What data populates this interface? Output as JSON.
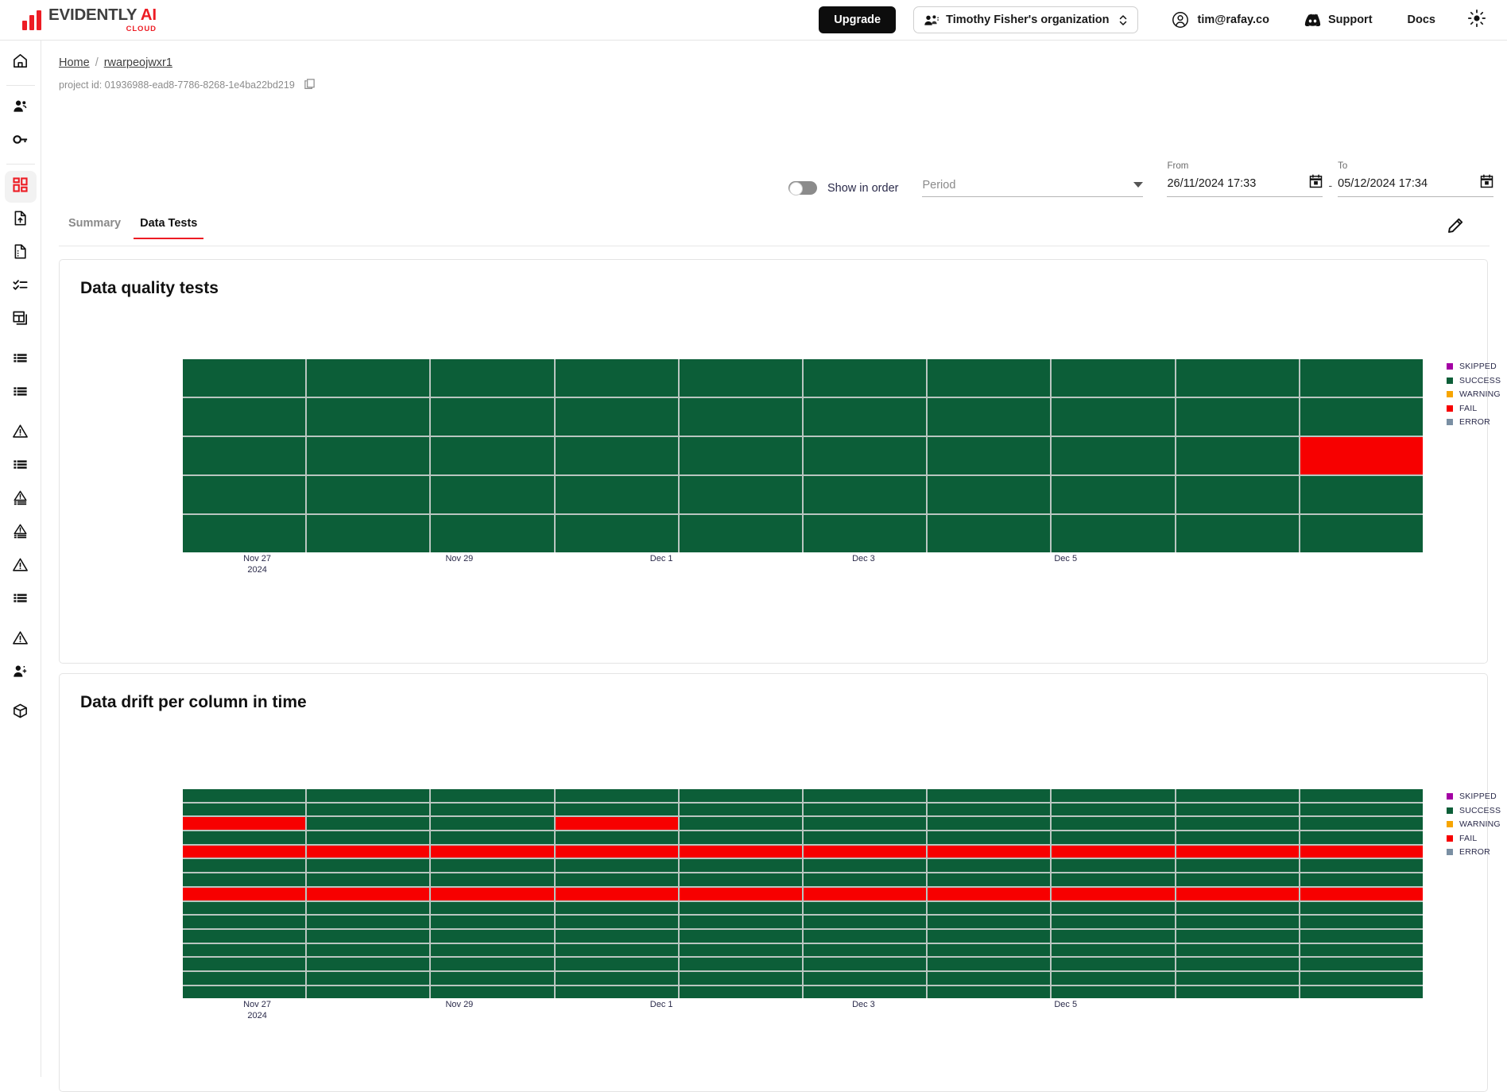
{
  "topbar": {
    "logo": {
      "main": "EVIDENTLY",
      "ai": "AI",
      "sub": "CLOUD"
    },
    "upgrade_label": "Upgrade",
    "org_label": "Timothy Fisher's organization",
    "account_email": "tim@rafay.co",
    "support_label": "Support",
    "docs_label": "Docs"
  },
  "sidebar": {
    "items": [
      {
        "name": "home",
        "icon": "home-icon"
      },
      {
        "name": "team",
        "icon": "users-icon"
      },
      {
        "name": "api-keys",
        "icon": "key-icon"
      },
      {
        "name": "dashboards",
        "icon": "dashboard-grid-icon",
        "active": true
      },
      {
        "name": "upload-snapshot",
        "icon": "file-upload-icon"
      },
      {
        "name": "reports",
        "icon": "file-text-icon"
      },
      {
        "name": "test-suites",
        "icon": "checklist-icon"
      },
      {
        "name": "panels",
        "icon": "panels-icon"
      },
      {
        "name": "datasets",
        "icon": "list-icon"
      },
      {
        "name": "columns",
        "icon": "list-icon"
      },
      {
        "name": "alerts",
        "icon": "warning-icon"
      },
      {
        "name": "data-list",
        "icon": "list-icon"
      },
      {
        "name": "data-alerts",
        "icon": "warning-list-icon"
      },
      {
        "name": "drift-alerts",
        "icon": "warning-list-icon"
      },
      {
        "name": "quality-warning",
        "icon": "warning-icon"
      },
      {
        "name": "quality-list",
        "icon": "list-icon"
      },
      {
        "name": "monitor-warning",
        "icon": "warning-icon"
      },
      {
        "name": "invite-user",
        "icon": "user-add-icon"
      },
      {
        "name": "integrations",
        "icon": "cube-icon"
      }
    ]
  },
  "breadcrumb": {
    "home": "Home",
    "separator": "/",
    "project": "rwarpeojwxr1"
  },
  "project": {
    "id_label": "project id: 01936988-ead8-7786-8268-1e4ba22bd219"
  },
  "controls": {
    "show_in_order_label": "Show in order",
    "show_in_order_on": false,
    "period_placeholder": "Period",
    "from_label": "From",
    "from_value": "26/11/2024 17:33",
    "separator": "-",
    "to_label": "To",
    "to_value": "05/12/2024 17:34"
  },
  "tabs": [
    {
      "label": "Summary",
      "active": false
    },
    {
      "label": "Data Tests",
      "active": true
    }
  ],
  "colors": {
    "skipped": "#a400a4",
    "success": "#0c5e38",
    "warning": "#f7a501",
    "fail": "#f70000",
    "error": "#7a8fa3",
    "accent": "#ed1c24",
    "grid": "#b9c6c0"
  },
  "legend": [
    {
      "label": "SKIPPED",
      "color": "#a400a4"
    },
    {
      "label": "SUCCESS",
      "color": "#0c5e38"
    },
    {
      "label": "WARNING",
      "color": "#f7a501"
    },
    {
      "label": "FAIL",
      "color": "#f70000"
    },
    {
      "label": "ERROR",
      "color": "#7a8fa3"
    }
  ],
  "chart_data": [
    {
      "type": "heatmap",
      "title": "Data quality tests",
      "xlabel": "",
      "ylabel": "",
      "rows": 5,
      "cols": 10,
      "xtick_labels": [
        "Nov 27\n2024",
        "Nov 29",
        "Dec 1",
        "Dec 3",
        "Dec 5"
      ],
      "xtick_positions_pct": [
        6.0,
        22.3,
        38.6,
        54.9,
        71.2
      ],
      "categories": [
        "SKIPPED",
        "SUCCESS",
        "WARNING",
        "FAIL",
        "ERROR"
      ],
      "legend_position": "right",
      "grid": true,
      "values": [
        [
          "SUCCESS",
          "SUCCESS",
          "SUCCESS",
          "SUCCESS",
          "SUCCESS",
          "SUCCESS",
          "SUCCESS",
          "SUCCESS",
          "SUCCESS",
          "SUCCESS"
        ],
        [
          "SUCCESS",
          "SUCCESS",
          "SUCCESS",
          "SUCCESS",
          "SUCCESS",
          "SUCCESS",
          "SUCCESS",
          "SUCCESS",
          "SUCCESS",
          "SUCCESS"
        ],
        [
          "SUCCESS",
          "SUCCESS",
          "SUCCESS",
          "SUCCESS",
          "SUCCESS",
          "SUCCESS",
          "SUCCESS",
          "SUCCESS",
          "SUCCESS",
          "FAIL"
        ],
        [
          "SUCCESS",
          "SUCCESS",
          "SUCCESS",
          "SUCCESS",
          "SUCCESS",
          "SUCCESS",
          "SUCCESS",
          "SUCCESS",
          "SUCCESS",
          "SUCCESS"
        ],
        [
          "SUCCESS",
          "SUCCESS",
          "SUCCESS",
          "SUCCESS",
          "SUCCESS",
          "SUCCESS",
          "SUCCESS",
          "SUCCESS",
          "SUCCESS",
          "SUCCESS"
        ]
      ]
    },
    {
      "type": "heatmap",
      "title": "Data drift per column in time",
      "xlabel": "",
      "ylabel": "",
      "rows": 15,
      "cols": 10,
      "xtick_labels": [
        "Nov 27\n2024",
        "Nov 29",
        "Dec 1",
        "Dec 3",
        "Dec 5"
      ],
      "xtick_positions_pct": [
        6.0,
        22.3,
        38.6,
        54.9,
        71.2
      ],
      "categories": [
        "SKIPPED",
        "SUCCESS",
        "WARNING",
        "FAIL",
        "ERROR"
      ],
      "legend_position": "right",
      "grid": true,
      "values": [
        [
          "SUCCESS",
          "SUCCESS",
          "SUCCESS",
          "SUCCESS",
          "SUCCESS",
          "SUCCESS",
          "SUCCESS",
          "SUCCESS",
          "SUCCESS",
          "SUCCESS"
        ],
        [
          "SUCCESS",
          "SUCCESS",
          "SUCCESS",
          "SUCCESS",
          "SUCCESS",
          "SUCCESS",
          "SUCCESS",
          "SUCCESS",
          "SUCCESS",
          "SUCCESS"
        ],
        [
          "FAIL",
          "SUCCESS",
          "SUCCESS",
          "FAIL",
          "SUCCESS",
          "SUCCESS",
          "SUCCESS",
          "SUCCESS",
          "SUCCESS",
          "SUCCESS"
        ],
        [
          "SUCCESS",
          "SUCCESS",
          "SUCCESS",
          "SUCCESS",
          "SUCCESS",
          "SUCCESS",
          "SUCCESS",
          "SUCCESS",
          "SUCCESS",
          "SUCCESS"
        ],
        [
          "FAIL",
          "FAIL",
          "FAIL",
          "FAIL",
          "FAIL",
          "FAIL",
          "FAIL",
          "FAIL",
          "FAIL",
          "FAIL"
        ],
        [
          "SUCCESS",
          "SUCCESS",
          "SUCCESS",
          "SUCCESS",
          "SUCCESS",
          "SUCCESS",
          "SUCCESS",
          "SUCCESS",
          "SUCCESS",
          "SUCCESS"
        ],
        [
          "SUCCESS",
          "SUCCESS",
          "SUCCESS",
          "SUCCESS",
          "SUCCESS",
          "SUCCESS",
          "SUCCESS",
          "SUCCESS",
          "SUCCESS",
          "SUCCESS"
        ],
        [
          "FAIL",
          "FAIL",
          "FAIL",
          "FAIL",
          "FAIL",
          "FAIL",
          "FAIL",
          "FAIL",
          "FAIL",
          "FAIL"
        ],
        [
          "SUCCESS",
          "SUCCESS",
          "SUCCESS",
          "SUCCESS",
          "SUCCESS",
          "SUCCESS",
          "SUCCESS",
          "SUCCESS",
          "SUCCESS",
          "SUCCESS"
        ],
        [
          "SUCCESS",
          "SUCCESS",
          "SUCCESS",
          "SUCCESS",
          "SUCCESS",
          "SUCCESS",
          "SUCCESS",
          "SUCCESS",
          "SUCCESS",
          "SUCCESS"
        ],
        [
          "SUCCESS",
          "SUCCESS",
          "SUCCESS",
          "SUCCESS",
          "SUCCESS",
          "SUCCESS",
          "SUCCESS",
          "SUCCESS",
          "SUCCESS",
          "SUCCESS"
        ],
        [
          "SUCCESS",
          "SUCCESS",
          "SUCCESS",
          "SUCCESS",
          "SUCCESS",
          "SUCCESS",
          "SUCCESS",
          "SUCCESS",
          "SUCCESS",
          "SUCCESS"
        ],
        [
          "SUCCESS",
          "SUCCESS",
          "SUCCESS",
          "SUCCESS",
          "SUCCESS",
          "SUCCESS",
          "SUCCESS",
          "SUCCESS",
          "SUCCESS",
          "SUCCESS"
        ],
        [
          "SUCCESS",
          "SUCCESS",
          "SUCCESS",
          "SUCCESS",
          "SUCCESS",
          "SUCCESS",
          "SUCCESS",
          "SUCCESS",
          "SUCCESS",
          "SUCCESS"
        ],
        [
          "SUCCESS",
          "SUCCESS",
          "SUCCESS",
          "SUCCESS",
          "SUCCESS",
          "SUCCESS",
          "SUCCESS",
          "SUCCESS",
          "SUCCESS",
          "SUCCESS"
        ]
      ]
    }
  ]
}
